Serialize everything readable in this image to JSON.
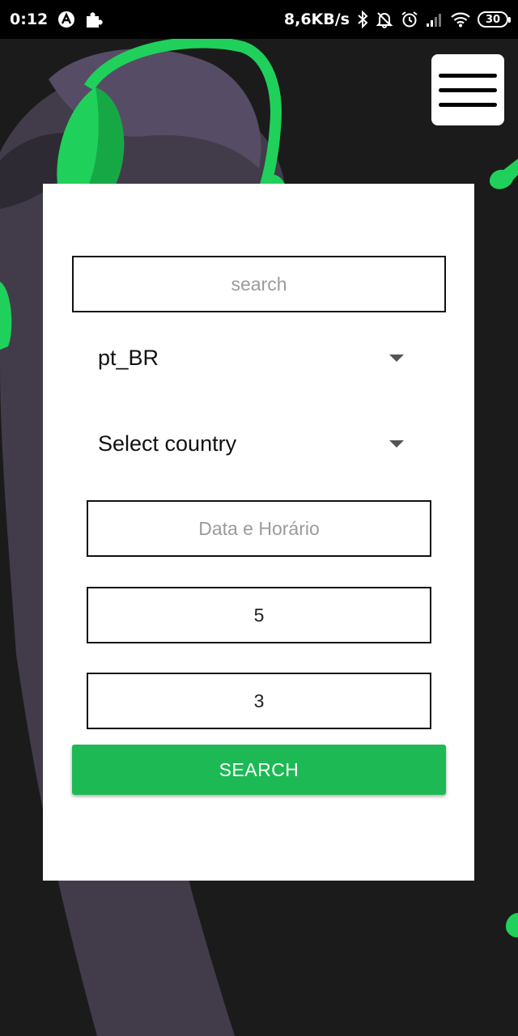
{
  "status_bar": {
    "time": "0:12",
    "net_speed": "8,6KB/s",
    "battery": "30",
    "icons": [
      "a-logo-icon",
      "puzzle-icon",
      "bluetooth-icon",
      "bell-off-icon",
      "alarm-icon",
      "signal-icon",
      "wifi-icon",
      "battery-icon"
    ]
  },
  "menu": {
    "icon": "hamburger-icon"
  },
  "form": {
    "search_placeholder": "search",
    "language_value": "pt_BR",
    "country_value": "Select country",
    "datetime_placeholder": "Data e Horário",
    "field_one_value": "5",
    "field_two_value": "3",
    "search_button": "SEARCH"
  },
  "colors": {
    "accent": "#1db954",
    "background": "#1b1b1c",
    "figure": "#4a4255"
  }
}
